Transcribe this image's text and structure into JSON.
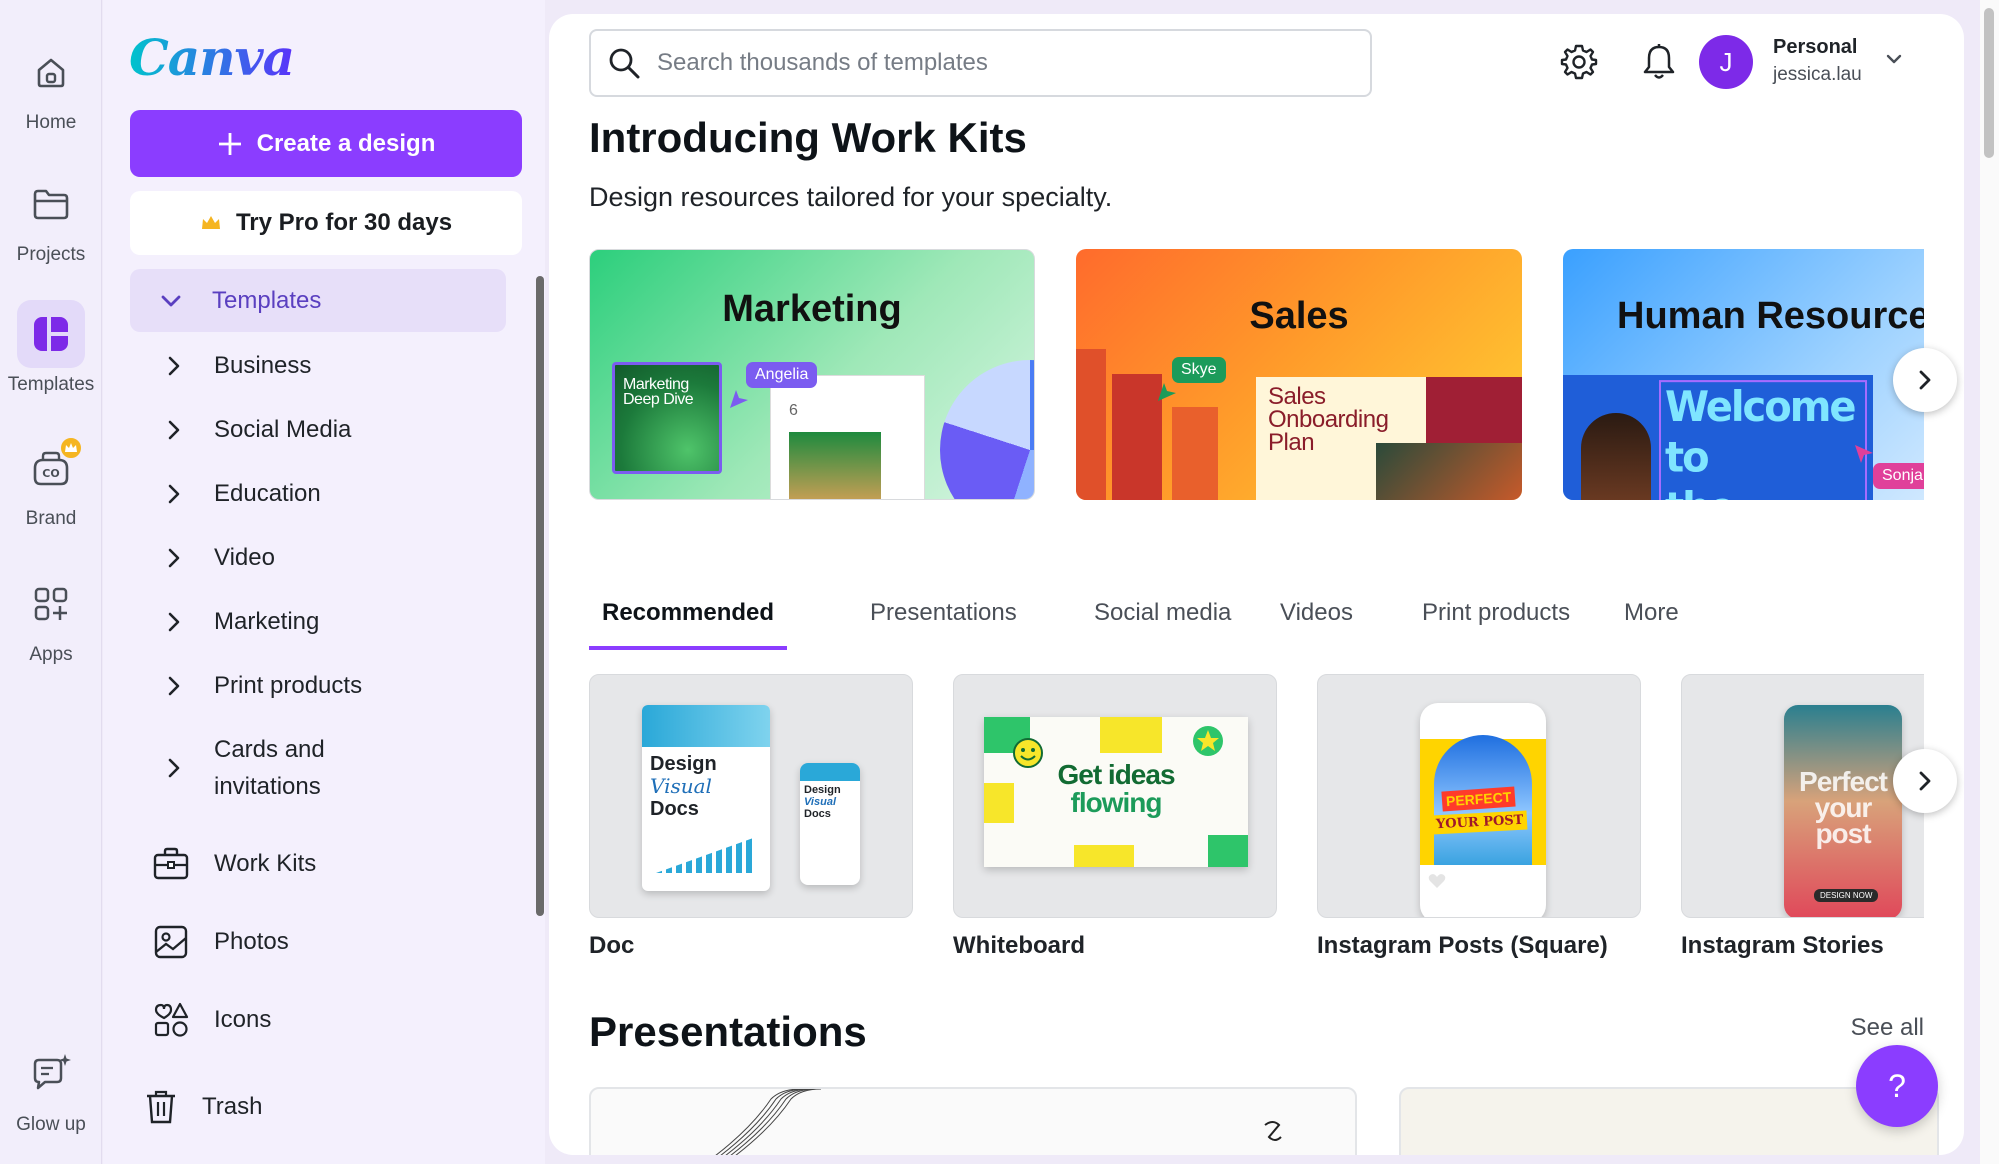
{
  "rail": {
    "home": "Home",
    "projects": "Projects",
    "templates": "Templates",
    "brand": "Brand",
    "apps": "Apps",
    "glowup": "Glow up"
  },
  "logo": "Canva",
  "panel": {
    "create_label": "Create a design",
    "pro_label": "Try Pro for 30 days",
    "templates_label": "Templates",
    "template_categories": [
      "Business",
      "Social Media",
      "Education",
      "Video",
      "Marketing",
      "Print products"
    ],
    "cards_line1": "Cards and",
    "cards_line2": "invitations",
    "nav": {
      "workkits": "Work Kits",
      "photos": "Photos",
      "icons": "Icons",
      "trash": "Trash"
    }
  },
  "search": {
    "placeholder": "Search thousands of templates"
  },
  "account": {
    "initial": "J",
    "name": "Personal",
    "username": "jessica.lau"
  },
  "hero": {
    "title": "Introducing Work Kits",
    "subtitle": "Design resources tailored for your specialty."
  },
  "kits": [
    {
      "title": "Marketing",
      "thumb_line1": "Marketing",
      "thumb_line2": "Deep Dive",
      "tag": "Angelia",
      "number": "6"
    },
    {
      "title": "Sales",
      "doc_line1": "Sales",
      "doc_line2": "Onboarding",
      "doc_line3": "Plan",
      "tag": "Skye"
    },
    {
      "title": "Human Resource",
      "poster_line1": "Welcome to",
      "poster_line2": "the team!",
      "tag": "Sonja"
    }
  ],
  "tabs": [
    "Recommended",
    "Presentations",
    "Social media",
    "Videos",
    "Print products",
    "More"
  ],
  "templates": [
    {
      "label": "Doc",
      "big_line1": "Design",
      "big_line2": "Visual",
      "big_line3": "Docs",
      "small_line1": "Design",
      "small_line2": "Visual",
      "small_line3": "Docs"
    },
    {
      "label": "Whiteboard",
      "line1": "Get ideas",
      "line2": "flowing"
    },
    {
      "label": "Instagram Posts (Square)",
      "line1": "PERFECT",
      "line2": "YOUR POST"
    },
    {
      "label": "Instagram Stories",
      "line1": "Perfect",
      "line2": "your",
      "line3": "post",
      "button": "DESIGN NOW"
    }
  ],
  "presentations": {
    "title": "Presentations",
    "see_all": "See all"
  },
  "help": {
    "label": "?"
  },
  "colors": {
    "accent": "#8b3dff",
    "rail_bg": "#f2eefb",
    "panel_bg": "#f4f0fd"
  }
}
